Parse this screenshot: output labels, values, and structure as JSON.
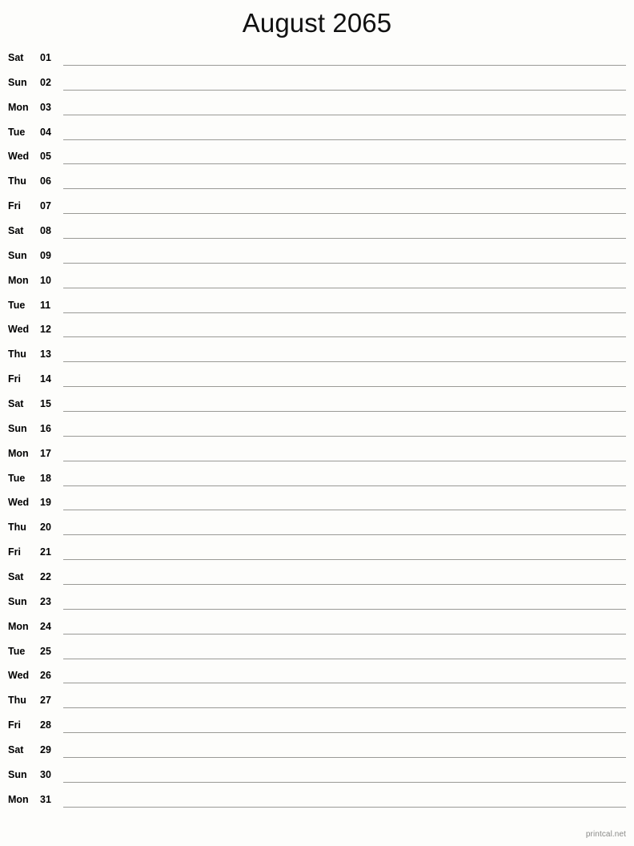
{
  "header": {
    "title": "August 2065"
  },
  "calendar": {
    "month": "August",
    "year": "2065",
    "days": [
      {
        "weekday": "Sat",
        "number": "01"
      },
      {
        "weekday": "Sun",
        "number": "02"
      },
      {
        "weekday": "Mon",
        "number": "03"
      },
      {
        "weekday": "Tue",
        "number": "04"
      },
      {
        "weekday": "Wed",
        "number": "05"
      },
      {
        "weekday": "Thu",
        "number": "06"
      },
      {
        "weekday": "Fri",
        "number": "07"
      },
      {
        "weekday": "Sat",
        "number": "08"
      },
      {
        "weekday": "Sun",
        "number": "09"
      },
      {
        "weekday": "Mon",
        "number": "10"
      },
      {
        "weekday": "Tue",
        "number": "11"
      },
      {
        "weekday": "Wed",
        "number": "12"
      },
      {
        "weekday": "Thu",
        "number": "13"
      },
      {
        "weekday": "Fri",
        "number": "14"
      },
      {
        "weekday": "Sat",
        "number": "15"
      },
      {
        "weekday": "Sun",
        "number": "16"
      },
      {
        "weekday": "Mon",
        "number": "17"
      },
      {
        "weekday": "Tue",
        "number": "18"
      },
      {
        "weekday": "Wed",
        "number": "19"
      },
      {
        "weekday": "Thu",
        "number": "20"
      },
      {
        "weekday": "Fri",
        "number": "21"
      },
      {
        "weekday": "Sat",
        "number": "22"
      },
      {
        "weekday": "Sun",
        "number": "23"
      },
      {
        "weekday": "Mon",
        "number": "24"
      },
      {
        "weekday": "Tue",
        "number": "25"
      },
      {
        "weekday": "Wed",
        "number": "26"
      },
      {
        "weekday": "Thu",
        "number": "27"
      },
      {
        "weekday": "Fri",
        "number": "28"
      },
      {
        "weekday": "Sat",
        "number": "29"
      },
      {
        "weekday": "Sun",
        "number": "30"
      },
      {
        "weekday": "Mon",
        "number": "31"
      }
    ]
  },
  "footer": {
    "credit": "printcal.net"
  },
  "colors": {
    "background": "#fdfdfb",
    "text": "#000000",
    "rule": "#9a9a96",
    "footer_text": "#8a8a88"
  }
}
